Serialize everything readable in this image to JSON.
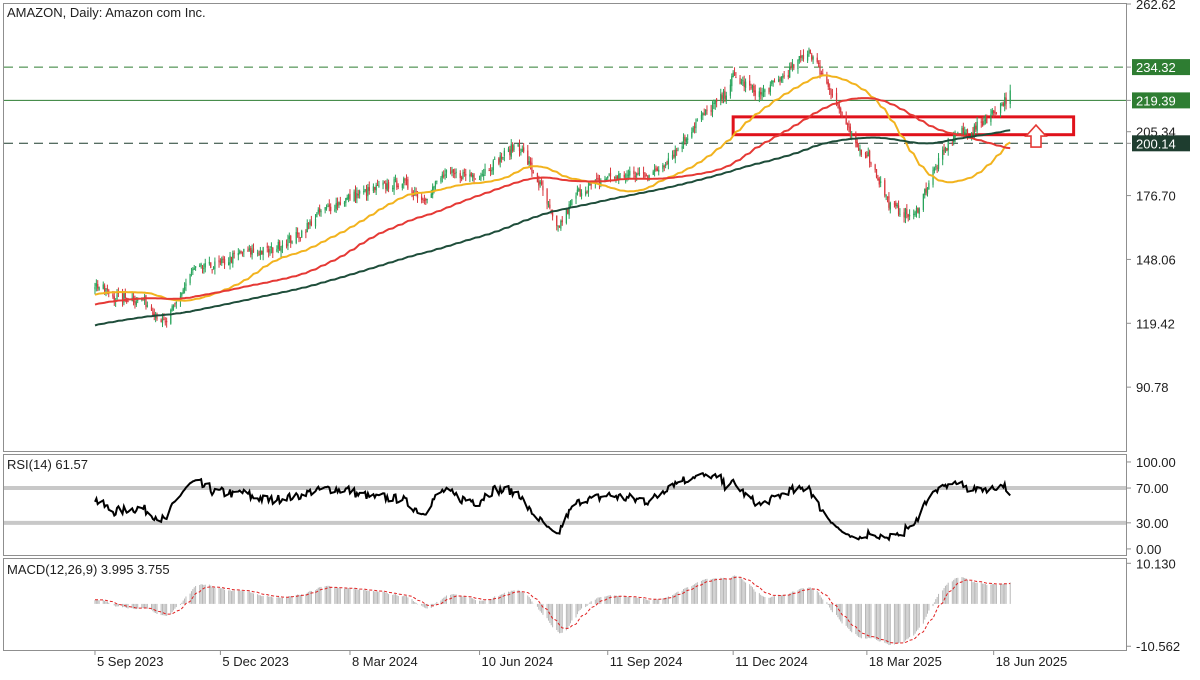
{
  "chart_data": [
    {
      "type": "candlestick",
      "title": "AMAZON, Daily:  Amazon com Inc.",
      "ylim": [
        62.14,
        262.62
      ],
      "y_ticks": [
        "262.62",
        "234.32",
        "219.39",
        "205.34",
        "200.14",
        "176.70",
        "148.06",
        "119.42",
        "90.78"
      ],
      "x_tick_labels": [
        "5 Sep 2023",
        "5 Dec 2023",
        "8 Mar 2024",
        "10 Jun 2024",
        "11 Sep 2024",
        "11 Dec 2024",
        "18 Mar 2025",
        "18 Jun 2025"
      ],
      "price_levels": [
        {
          "value": 234.32,
          "label": "234.32",
          "style": "dashed",
          "color": "#2e7d32",
          "label_bg": "#2e7d32"
        },
        {
          "value": 219.39,
          "label": "219.39",
          "style": "solid",
          "color": "#2e7d32",
          "label_bg": "#2e7d32"
        },
        {
          "value": 200.14,
          "label": "200.14",
          "style": "dashed",
          "color": "#1e3d2f",
          "label_bg": "#1e3d2f"
        }
      ],
      "close_path": [
        [
          "2023-09-05",
          137
        ],
        [
          "2023-09-20",
          131
        ],
        [
          "2023-10-10",
          130
        ],
        [
          "2023-10-26",
          119
        ],
        [
          "2023-11-15",
          143
        ],
        [
          "2023-12-05",
          146
        ],
        [
          "2023-12-20",
          151
        ],
        [
          "2024-01-10",
          152
        ],
        [
          "2024-01-31",
          159
        ],
        [
          "2024-02-15",
          169
        ],
        [
          "2024-03-08",
          176
        ],
        [
          "2024-03-28",
          180
        ],
        [
          "2024-04-15",
          183
        ],
        [
          "2024-04-30",
          175
        ],
        [
          "2024-05-15",
          186
        ],
        [
          "2024-06-10",
          186
        ],
        [
          "2024-07-08",
          200
        ],
        [
          "2024-07-25",
          180
        ],
        [
          "2024-08-05",
          161
        ],
        [
          "2024-08-20",
          178
        ],
        [
          "2024-09-11",
          185
        ],
        [
          "2024-09-30",
          186
        ],
        [
          "2024-10-15",
          187
        ],
        [
          "2024-11-01",
          198
        ],
        [
          "2024-11-15",
          210
        ],
        [
          "2024-12-05",
          222
        ],
        [
          "2024-12-11",
          230
        ],
        [
          "2024-12-31",
          222
        ],
        [
          "2025-01-20",
          232
        ],
        [
          "2025-02-04",
          242
        ],
        [
          "2025-02-20",
          224
        ],
        [
          "2025-03-10",
          198
        ],
        [
          "2025-03-18",
          196
        ],
        [
          "2025-04-04",
          172
        ],
        [
          "2025-04-21",
          167
        ],
        [
          "2025-05-05",
          187
        ],
        [
          "2025-05-20",
          204
        ],
        [
          "2025-06-03",
          206
        ],
        [
          "2025-06-18",
          214
        ],
        [
          "2025-06-30",
          222
        ]
      ],
      "moving_averages": [
        {
          "color": "#f2b31e"
        },
        {
          "color": "#e53935"
        },
        {
          "color": "#1e4d3a"
        }
      ],
      "annotation_box": {
        "top": 212,
        "bottom": 204,
        "start": "2024-12-11",
        "end": "2025-08-15",
        "color": "#e0121b"
      },
      "annotation_arrow": {
        "direction": "up",
        "color": "#e53935"
      }
    },
    {
      "type": "line",
      "label": "RSI(14) 61.57",
      "ylim": [
        -7,
        108
      ],
      "y_ticks": [
        "100.00",
        "70.00",
        "30.00",
        "0.00"
      ],
      "levels": [
        70,
        30
      ],
      "current": 61.57
    },
    {
      "type": "bar",
      "label": "MACD(12,26,9) 3.995 3.755",
      "ylim": [
        -11.5,
        11.2
      ],
      "y_ticks": [
        "10.130",
        "-10.562"
      ],
      "macd": 3.995,
      "signal": 3.755
    }
  ]
}
